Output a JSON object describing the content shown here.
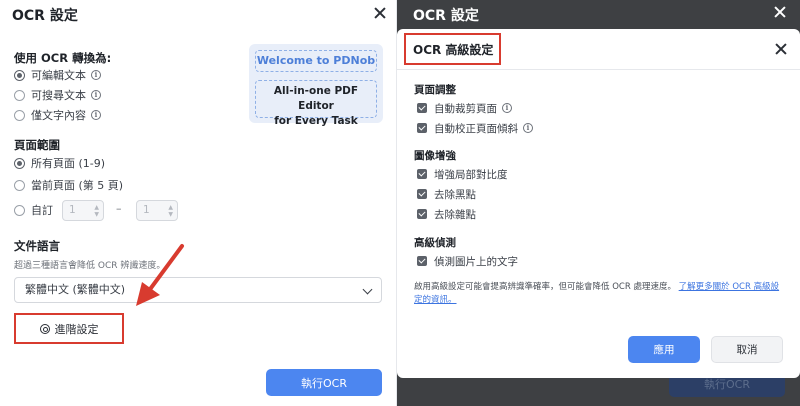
{
  "left_dialog": {
    "title": "OCR 設定",
    "convert_section": {
      "title": "使用 OCR 轉換為:",
      "options": [
        {
          "label": "可編輯文本",
          "selected": true,
          "info": true
        },
        {
          "label": "可搜尋文本",
          "selected": false,
          "info": true
        },
        {
          "label": "僅文字內容",
          "selected": false,
          "info": true
        }
      ]
    },
    "promo": {
      "headline": "Welcome to PDNob",
      "tagline_line1": "All-in-one PDF Editor",
      "tagline_line2": "for Every Task"
    },
    "page_range": {
      "title": "頁面範圍",
      "options": [
        {
          "label": "所有頁面 (1-9)",
          "selected": true
        },
        {
          "label": "當前頁面 (第 5 頁)",
          "selected": false
        },
        {
          "label": "自訂",
          "selected": false
        }
      ],
      "from_value": "1",
      "separator": "–",
      "to_value": "1"
    },
    "language": {
      "title": "文件語言",
      "hint": "超過三種語言會降低 OCR 辨識速度。",
      "selected": "繁體中文 (繁體中文)"
    },
    "advanced_button": "進階設定",
    "run_button": "執行OCR"
  },
  "background_dialog": {
    "title": "OCR 設定",
    "run_button": "執行OCR"
  },
  "advanced_dialog": {
    "title": "OCR 高級設定",
    "sections": [
      {
        "title": "頁面調整",
        "items": [
          {
            "label": "自動裁剪頁面",
            "checked": true,
            "info": true
          },
          {
            "label": "自動校正頁面傾斜",
            "checked": true,
            "info": true
          }
        ]
      },
      {
        "title": "圖像增強",
        "items": [
          {
            "label": "增強局部對比度",
            "checked": true
          },
          {
            "label": "去除黑點",
            "checked": true
          },
          {
            "label": "去除雜點",
            "checked": true
          }
        ]
      },
      {
        "title": "高級偵測",
        "items": [
          {
            "label": "偵測圖片上的文字",
            "checked": true
          }
        ]
      }
    ],
    "note": "啟用高級設定可能會提高辨識準確率，但可能會降低 OCR 處理速度。",
    "note_link": "了解更多關於 OCR 高級設定的資訊。",
    "apply_button": "應用",
    "cancel_button": "取消"
  },
  "colors": {
    "accent": "#4c86f0",
    "highlight_red": "#d83b2f",
    "overlay": "#3e4043"
  }
}
